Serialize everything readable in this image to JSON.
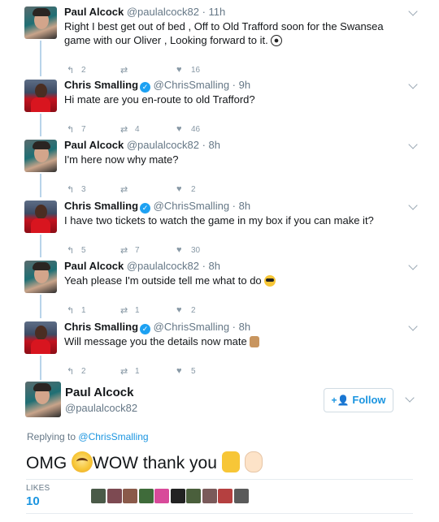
{
  "thread": [
    {
      "name": "Paul Alcock",
      "handle": "@paulalcock82",
      "time": "· 11h",
      "verified": false,
      "avatar": "paul",
      "text": "Right I best get out of bed , Off to Old Trafford soon for the Swansea game with our Oliver , Looking forward to it.",
      "emoji": "soccer-ball",
      "replies": "2",
      "retweets": "",
      "likes": "16"
    },
    {
      "name": "Chris Smalling",
      "handle": "@ChrisSmalling",
      "time": "· 9h",
      "verified": true,
      "avatar": "chris",
      "text": "Hi mate are you en-route to old Trafford?",
      "replies": "7",
      "retweets": "4",
      "likes": "46"
    },
    {
      "name": "Paul Alcock",
      "handle": "@paulalcock82",
      "time": "· 8h",
      "verified": false,
      "avatar": "paul",
      "text": "I'm here now why mate?",
      "replies": "3",
      "retweets": "",
      "likes": "2"
    },
    {
      "name": "Chris Smalling",
      "handle": "@ChrisSmalling",
      "time": "· 8h",
      "verified": true,
      "avatar": "chris",
      "text": "I have two tickets to watch the game in my box if you can make it?",
      "replies": "5",
      "retweets": "7",
      "likes": "30"
    },
    {
      "name": "Paul Alcock",
      "handle": "@paulalcock82",
      "time": "· 8h",
      "verified": false,
      "avatar": "paul",
      "text": "Yeah please I'm outside tell me what to do",
      "emoji": "sunglasses-face",
      "replies": "1",
      "retweets": "1",
      "likes": "2"
    },
    {
      "name": "Chris Smalling",
      "handle": "@ChrisSmalling",
      "time": "· 8h",
      "verified": true,
      "avatar": "chris",
      "text": "Will message you the details now mate",
      "emoji": "pointing-hand",
      "replies": "2",
      "retweets": "1",
      "likes": "5"
    }
  ],
  "main_tweet": {
    "name": "Paul Alcock",
    "handle": "@paulalcock82",
    "follow_label": "Follow",
    "replying_prefix": "Replying to",
    "replying_to": "@ChrisSmalling",
    "text_part1": "OMG",
    "text_part2": "WOW thank you",
    "emojis": [
      "flushed-face",
      "thumbs-up",
      "ok-hand"
    ],
    "likes_label": "LIKES",
    "likes_count": "10",
    "liker_colors": [
      "#4a5a48",
      "#7d4a52",
      "#8a5a4a",
      "#3f6b3a",
      "#d84a9a",
      "#222222",
      "#4a5f3c",
      "#7a5a5a",
      "#b54040",
      "#5a5a5a"
    ]
  },
  "colors": {
    "accent": "#1da1f2",
    "link": "#1b95e0",
    "muted": "#657786",
    "thread_line": "#b8d4ea"
  }
}
